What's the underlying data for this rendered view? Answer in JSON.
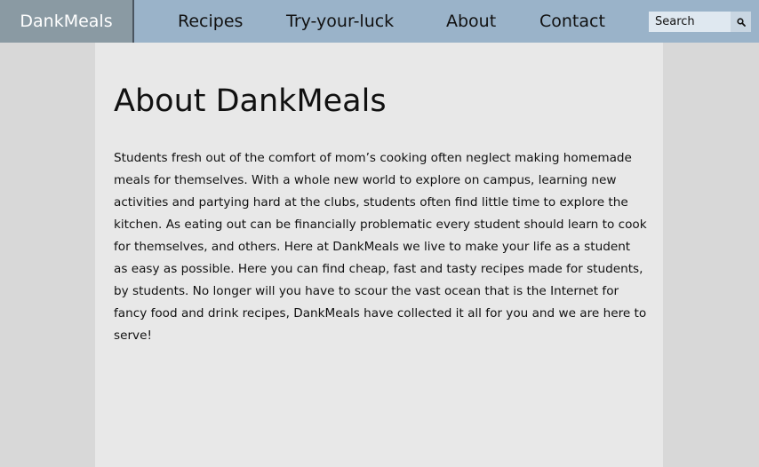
{
  "nav": {
    "brand": "DankMeals",
    "links": [
      "Recipes",
      "Try-your-luck",
      "About",
      "Contact"
    ],
    "search": {
      "placeholder": "Search",
      "icon": "search-icon"
    }
  },
  "main": {
    "title": "About DankMeals",
    "paragraph": "Students fresh out of the comfort of mom’s cooking often neglect making homemade meals for themselves. With a whole new world to explore on campus, learning new activities and partying hard at the clubs, students often find little time to explore the kitchen. As eating out can be financially problematic every student should learn to cook for themselves, and others. Here at DankMeals we live to make your life as a student as easy as possible. Here you can find cheap, fast and tasty recipes made for students, by students. No longer will you have to scour the vast ocean that is the Internet for fancy food and drink recipes, DankMeals have collected it all for you and we are here to serve!"
  },
  "colors": {
    "navbar": "#9ab3c9",
    "brand_bg": "#8a9aa3",
    "page_bg": "#d8d8d8",
    "content_bg": "#e8e8e8"
  }
}
